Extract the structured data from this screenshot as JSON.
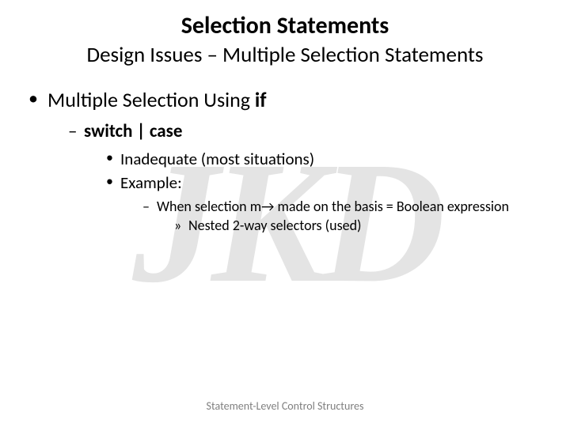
{
  "watermark": "JKD",
  "title": "Selection Statements",
  "subtitle": "Design Issues – Multiple Selection Statements",
  "bullet1_prefix": "Multiple Selection Using ",
  "bullet1_bold": "if",
  "bullet2": "switch | case",
  "bullet3a": "Inadequate (most situations)",
  "bullet3b": "Example:",
  "bullet4": "When selection m→ made on the basis = Boolean expression",
  "bullet5": "Nested 2-way selectors (used)",
  "footer": "Statement-Level Control Structures"
}
